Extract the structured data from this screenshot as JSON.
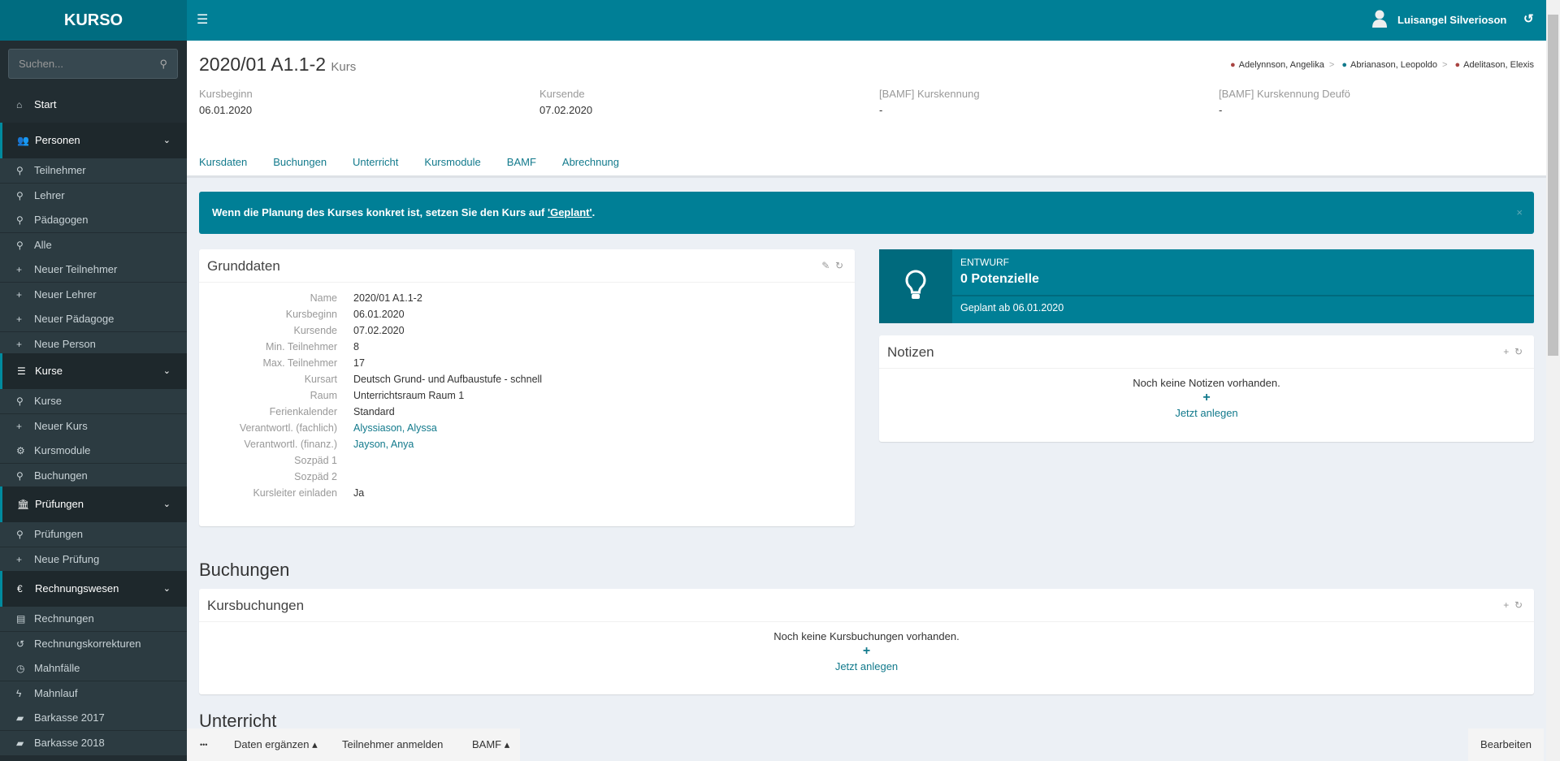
{
  "app": {
    "logo": "KURSO",
    "user": "Luisangel Silverioson",
    "search_placeholder": "Suchen..."
  },
  "sidebar": {
    "start": "Start",
    "sections": [
      {
        "label": "Personen",
        "items": [
          "Teilnehmer",
          "Lehrer",
          "Pädagogen",
          "Alle",
          "Neuer Teilnehmer",
          "Neuer Lehrer",
          "Neuer Pädagoge",
          "Neue Person"
        ]
      },
      {
        "label": "Kurse",
        "items": [
          "Kurse",
          "Neuer Kurs",
          "Kursmodule",
          "Buchungen"
        ]
      },
      {
        "label": "Prüfungen",
        "items": [
          "Prüfungen",
          "Neue Prüfung"
        ]
      },
      {
        "label": "Rechnungswesen",
        "items": [
          "Rechnungen",
          "Rechnungskorrekturen",
          "Mahnfälle",
          "Mahnlauf",
          "Barkasse 2017",
          "Barkasse 2018"
        ]
      }
    ]
  },
  "header": {
    "title": "2020/01 A1.1-2",
    "subtitle": "Kurs",
    "breadcrumbs": [
      "Adelynnson, Angelika",
      "Abrianason, Leopoldo",
      "Adelitason, Elexis"
    ],
    "sep": ">",
    "info": [
      {
        "label": "Kursbeginn",
        "value": "06.01.2020"
      },
      {
        "label": "Kursende",
        "value": "07.02.2020"
      },
      {
        "label": "[BAMF] Kurskennung",
        "value": "-"
      },
      {
        "label": "[BAMF] Kurskennung Deufö",
        "value": "-"
      }
    ],
    "tabs": [
      "Kursdaten",
      "Buchungen",
      "Unterricht",
      "Kursmodule",
      "BAMF",
      "Abrechnung"
    ]
  },
  "alert": {
    "text": "Wenn die Planung des Kurses konkret ist, setzen Sie den Kurs auf ",
    "link": "'Geplant'",
    "end": ".",
    "close": "×"
  },
  "grunddaten": {
    "title": "Grunddaten",
    "rows": [
      {
        "k": "Name",
        "v": "2020/01 A1.1-2"
      },
      {
        "k": "Kursbeginn",
        "v": "06.01.2020"
      },
      {
        "k": "Kursende",
        "v": "07.02.2020"
      },
      {
        "k": "Min. Teilnehmer",
        "v": "8"
      },
      {
        "k": "Max. Teilnehmer",
        "v": "17"
      },
      {
        "k": "Kursart",
        "v": "Deutsch Grund- und Aufbaustufe - schnell"
      },
      {
        "k": "Raum",
        "v": "Unterrichtsraum Raum 1"
      },
      {
        "k": "Ferienkalender",
        "v": "Standard"
      },
      {
        "k": "Verantwortl. (fachlich)",
        "v": "Alyssiason, Alyssa"
      },
      {
        "k": "Verantwortl. (finanz.)",
        "v": "Jayson, Anya"
      },
      {
        "k": "Sozpäd 1",
        "v": ""
      },
      {
        "k": "Sozpäd 2",
        "v": ""
      },
      {
        "k": "Kursleiter einladen",
        "v": "Ja"
      }
    ]
  },
  "status": {
    "label": "ENTWURF",
    "count": "0 Potenzielle",
    "planned": "Geplant ab 06.01.2020"
  },
  "notizen": {
    "title": "Notizen",
    "empty": "Noch keine Notizen vorhanden.",
    "create": "Jetzt anlegen"
  },
  "buchungen": {
    "heading": "Buchungen",
    "title": "Kursbuchungen",
    "empty": "Noch keine Kursbuchungen vorhanden.",
    "create": "Jetzt anlegen"
  },
  "unterricht": {
    "heading": "Unterricht"
  },
  "bottombar": {
    "more": "•••",
    "daten": "Daten ergänzen ▴",
    "anmelden": "Teilnehmer anmelden",
    "bamf": "BAMF ▴",
    "edit": "Bearbeiten"
  },
  "colors": {
    "primary": "#007f96",
    "sidebar": "#222d32",
    "link": "#127a8c"
  }
}
